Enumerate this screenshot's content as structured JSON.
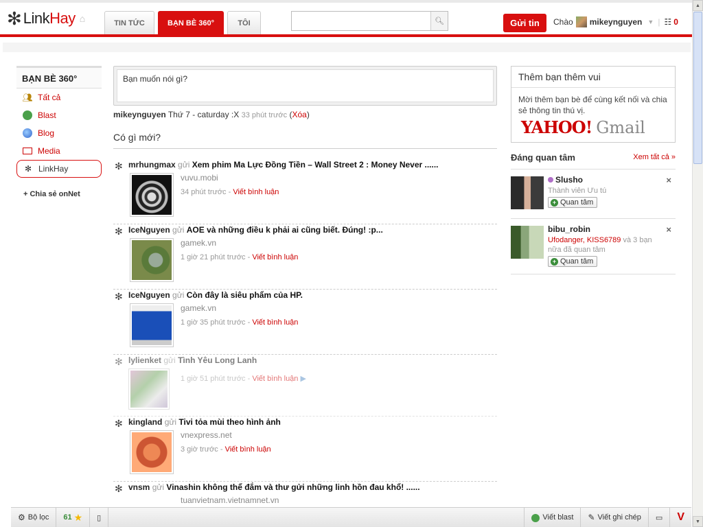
{
  "header": {
    "logo_part1": "Link",
    "logo_part2": "Hay",
    "tabs": [
      {
        "label": "TIN TỨC"
      },
      {
        "label": "BẠN BÈ 360°"
      },
      {
        "label": "TÔI"
      }
    ],
    "search_placeholder": "",
    "post_button": "Gửi tin",
    "greeting": "Chào",
    "username": "mikeynguyen",
    "notif_count": "0"
  },
  "leftnav": {
    "title": "BẠN BÈ 360°",
    "items": [
      {
        "label": "Tất cả",
        "icon": "people-icon"
      },
      {
        "label": "Blast",
        "icon": "blast-icon"
      },
      {
        "label": "Blog",
        "icon": "globe-icon"
      },
      {
        "label": "Media",
        "icon": "media-icon"
      },
      {
        "label": "LinkHay",
        "icon": "linkhay-icon"
      }
    ],
    "share": "+ Chia sẻ onNet"
  },
  "composer": {
    "placeholder": "Bạn muốn nói gì?"
  },
  "status": {
    "user": "mikeynguyen",
    "text": "Thứ 7 - caturday :X",
    "time": "33 phút trước",
    "delete_open": "(",
    "delete": "Xóa",
    "delete_close": ")"
  },
  "whats_new": "Có gì mới?",
  "feed": [
    {
      "who": "mrhungmax",
      "verb": "gửi",
      "title": "Xem phim Ma Lực Đồng Tiền – Wall Street 2 : Money Never ......",
      "source": "vuvu.mobi",
      "time": "34 phút trước",
      "comment": "Viết bình luận"
    },
    {
      "who": "IceNguyen",
      "verb": "gửi",
      "title": "AOE và những điều k phải ai cũng biết. Đúng! :p...",
      "source": "gamek.vn",
      "time": "1 giờ 21 phút trước",
      "comment": "Viết bình luận"
    },
    {
      "who": "IceNguyen",
      "verb": "gửi",
      "title": "Còn đây là siêu phẩm của HP.",
      "source": "gamek.vn",
      "time": "1 giờ 35 phút trước",
      "comment": "Viết bình luận"
    },
    {
      "who": "lylienket",
      "verb": "gửi",
      "title": "Tình Yêu Long Lanh",
      "source": "",
      "time": "1 giờ 51 phút trước",
      "comment": "Viết bình luận"
    },
    {
      "who": "kingland",
      "verb": "gửi",
      "title": "Tivi tỏa mùi theo hình ảnh",
      "source": "vnexpress.net",
      "time": "3 giờ trước",
      "comment": "Viết bình luận"
    },
    {
      "who": "vnsm",
      "verb": "gửi",
      "title": "Vinashin không thể đắm và thư gửi những linh hồn đau khổ! ......",
      "source": "tuanvietnam.vietnamnet.vn",
      "time": "",
      "comment": ""
    }
  ],
  "invite": {
    "title": "Thêm bạn thêm vui",
    "text": "Mời thêm bạn bè để cùng kết nối và chia sẻ thông tin thú vị.",
    "yahoo": "YAHOO!",
    "gmail": "Gmail"
  },
  "care": {
    "title": "Đáng quan tâm",
    "see_all": "Xem tất cả »",
    "people": [
      {
        "name": "Slusho",
        "sub": "Thành viên Ưu tú",
        "button": "Quan tâm"
      },
      {
        "name": "bibu_robin",
        "sub_link": "Ufodanger, KISS6789",
        "sub_rest": " và 3 bạn nữa đã quan tâm",
        "button": "Quan tâm"
      }
    ]
  },
  "bottombar": {
    "filter": "Bộ lọc",
    "count": "61",
    "write_blast": "Viết blast",
    "write_note": "Viết ghi chép",
    "v": "V"
  },
  "colors": {
    "brand_red": "#d80f0f",
    "link_red": "#cc0000"
  }
}
